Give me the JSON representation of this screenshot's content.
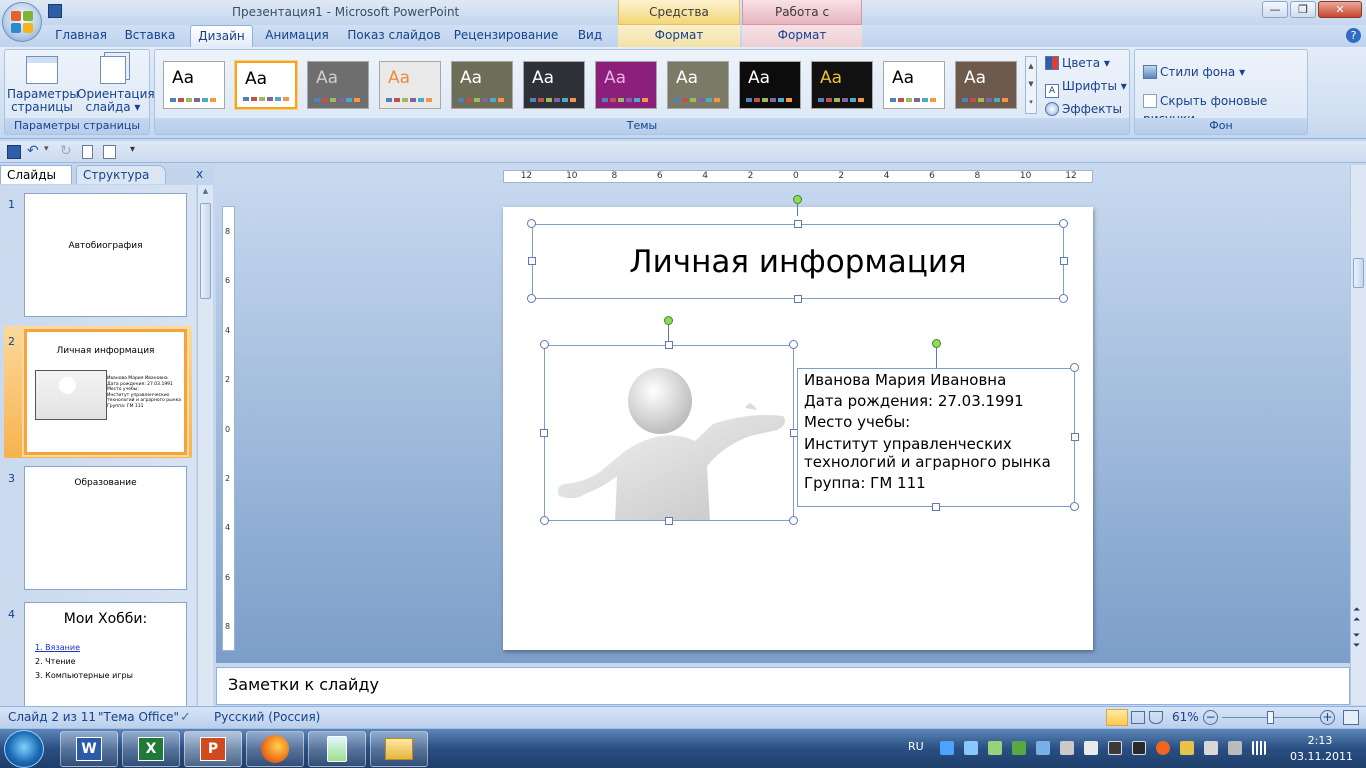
{
  "window": {
    "title": "Презентация1 - Microsoft PowerPoint",
    "context_tabs": {
      "drawing": "Средства рисования",
      "picture": "Работа с рисунками"
    },
    "controls": {
      "minimize": "—",
      "restore": "❐",
      "close": "✕"
    }
  },
  "tabs": [
    {
      "label": "Главная"
    },
    {
      "label": "Вставка"
    },
    {
      "label": "Дизайн",
      "active": true
    },
    {
      "label": "Анимация"
    },
    {
      "label": "Показ слайдов"
    },
    {
      "label": "Рецензирование"
    },
    {
      "label": "Вид"
    },
    {
      "label": "Формат"
    },
    {
      "label": "Формат"
    }
  ],
  "ribbon": {
    "page_setup": {
      "group_label": "Параметры страницы",
      "page_params": "Параметры страницы",
      "orientation": "Ориентация слайда ▾"
    },
    "themes": {
      "group_label": "Темы",
      "items": [
        {
          "text": "Aa",
          "bg": "#ffffff",
          "fg": "#000000"
        },
        {
          "text": "Aa",
          "bg": "#ffffff",
          "fg": "#000000",
          "selected": true
        },
        {
          "text": "Aa",
          "bg": "#6e6e6e",
          "fg": "#cfcfcf"
        },
        {
          "text": "Aa",
          "bg": "#e9e9e9",
          "fg": "#f08a3a"
        },
        {
          "text": "Aa",
          "bg": "#6c6e58",
          "fg": "#ffffff"
        },
        {
          "text": "Aa",
          "bg": "#2f3138",
          "fg": "#ffffff"
        },
        {
          "text": "Aa",
          "bg": "#8b1f7b",
          "fg": "#e8b3e0"
        },
        {
          "text": "Aa",
          "bg": "#7a7a66",
          "fg": "#ffffff"
        },
        {
          "text": "Aa",
          "bg": "#0c0c0c",
          "fg": "#ffffff"
        },
        {
          "text": "Aa",
          "bg": "#111111",
          "fg": "#f0c030"
        },
        {
          "text": "Aa",
          "bg": "#ffffff",
          "fg": "#000000"
        },
        {
          "text": "Aa",
          "bg": "#6e5a4c",
          "fg": "#ffffff"
        }
      ],
      "colors": "Цвета ▾",
      "fonts": "Шрифты ▾",
      "effects": "Эффекты ▾"
    },
    "background": {
      "group_label": "Фон",
      "styles": "Стили фона ▾",
      "hide_graphics": "Скрыть фоновые рисунки"
    }
  },
  "panel": {
    "tab_slides": "Слайды",
    "tab_outline": "Структура",
    "close": "x",
    "thumbnails": [
      {
        "num": "1",
        "title": "Автобиография"
      },
      {
        "num": "2",
        "title": "Личная информация",
        "lines": [
          "Иванова Мария Ивановна",
          "Дата рождения: 27.03.1991",
          "Место учебы:",
          "Институт управленческих",
          "технологий и аграрного рынка",
          "Группа: ГМ 111"
        ]
      },
      {
        "num": "3",
        "title": "Образование"
      },
      {
        "num": "4",
        "title": "Мои Хобби:",
        "list": [
          "1. Вязание",
          "2. Чтение",
          "3. Компьютерные игры"
        ]
      }
    ]
  },
  "ruler": {
    "h": [
      "12",
      "10",
      "8",
      "6",
      "4",
      "2",
      "0",
      "2",
      "4",
      "6",
      "8",
      "10",
      "12"
    ],
    "v": [
      "8",
      "6",
      "4",
      "2",
      "0",
      "2",
      "4",
      "6",
      "8"
    ]
  },
  "slide": {
    "title": "Личная информация",
    "text_lines": [
      "Иванова Мария Ивановна",
      "Дата рождения: 27.03.1991",
      "Место учебы:",
      "Институт управленческих технологий и аграрного рынка",
      "Группа: ГМ 111"
    ]
  },
  "notes": "Заметки к слайду",
  "status": {
    "slide": "Слайд 2 из 11",
    "theme": "\"Тема Office\"",
    "language": "Русский (Россия)",
    "zoom": "61%",
    "zoom_level": 61
  },
  "taskbar": {
    "lang": "RU",
    "time": "2:13",
    "date": "03.11.2011"
  }
}
